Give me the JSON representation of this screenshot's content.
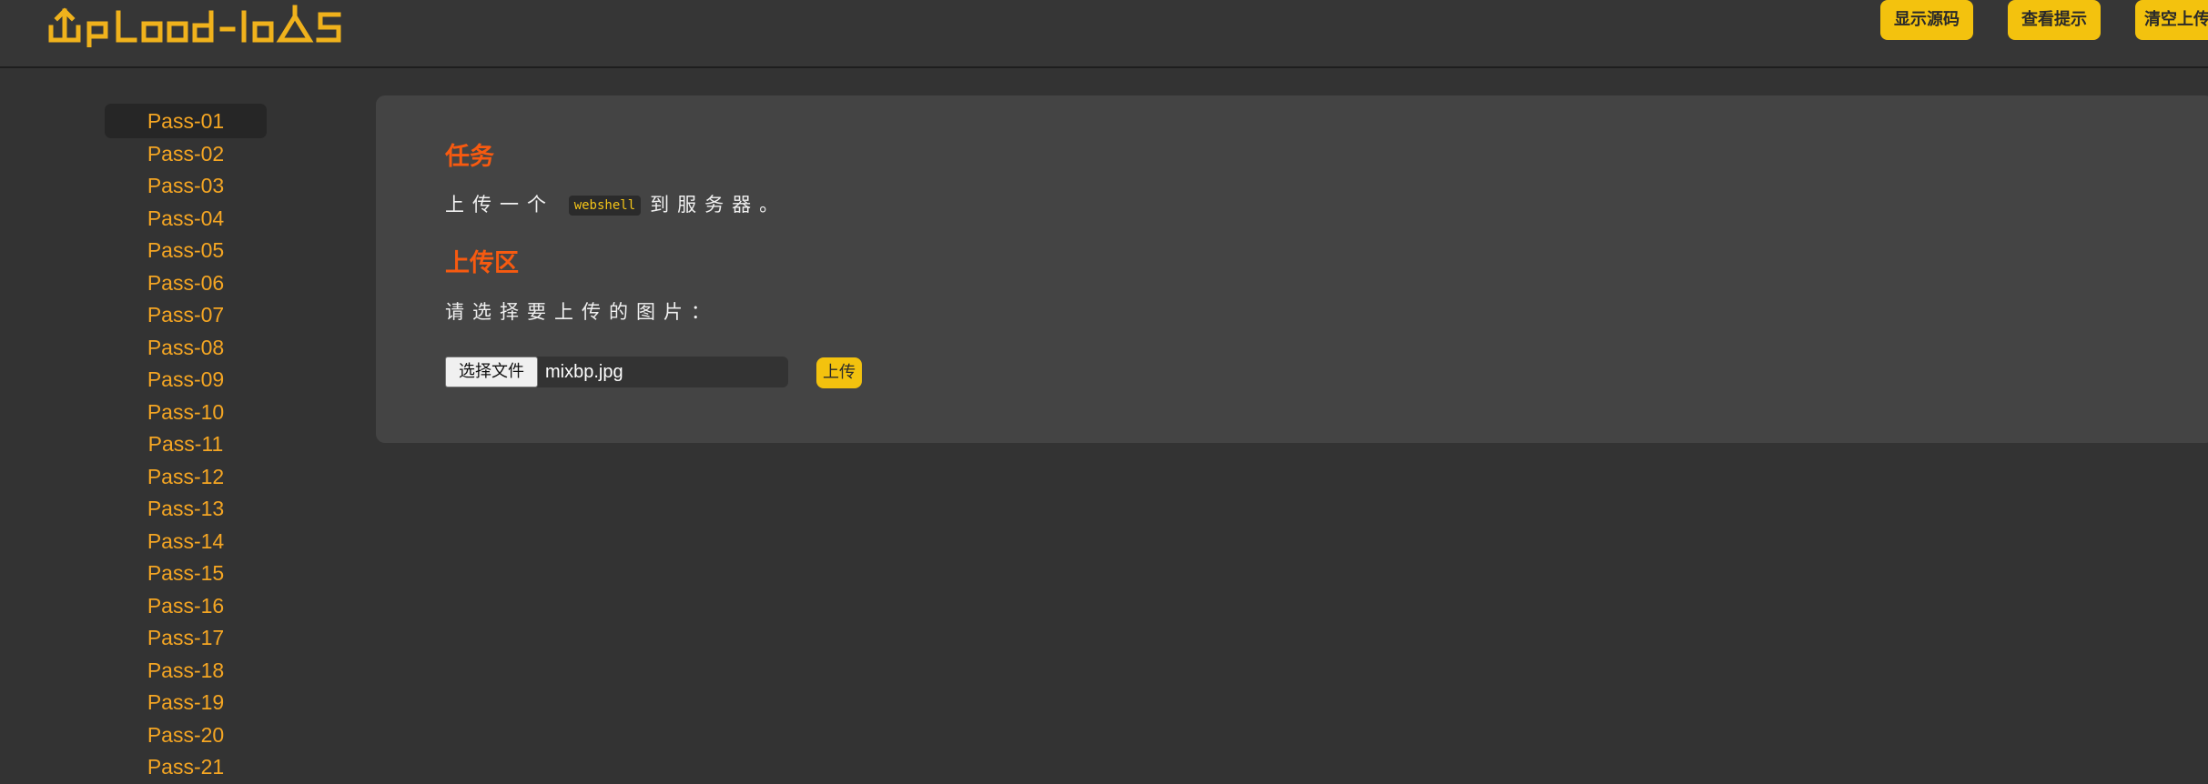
{
  "header": {
    "logo_text": "Upload-labs",
    "buttons": [
      "显示源码",
      "查看提示",
      "清空上传"
    ]
  },
  "sidebar": {
    "items": [
      "Pass-01",
      "Pass-02",
      "Pass-03",
      "Pass-04",
      "Pass-05",
      "Pass-06",
      "Pass-07",
      "Pass-08",
      "Pass-09",
      "Pass-10",
      "Pass-11",
      "Pass-12",
      "Pass-13",
      "Pass-14",
      "Pass-15",
      "Pass-16",
      "Pass-17",
      "Pass-18",
      "Pass-19",
      "Pass-20",
      "Pass-21"
    ],
    "active_index": 0
  },
  "task": {
    "title": "任务",
    "text_before": "上传一个",
    "code": "webshell",
    "text_after": "到服务器。"
  },
  "upload": {
    "title": "上传区",
    "prompt": "请选择要上传的图片：",
    "choose_label": "选择文件",
    "file_name": "mixbp.jpg",
    "submit_label": "上传"
  },
  "colors": {
    "background": "#333333",
    "accent_yellow": "#f3c20e",
    "nav_orange": "#f5a623",
    "heading_orange": "#f75a10"
  }
}
